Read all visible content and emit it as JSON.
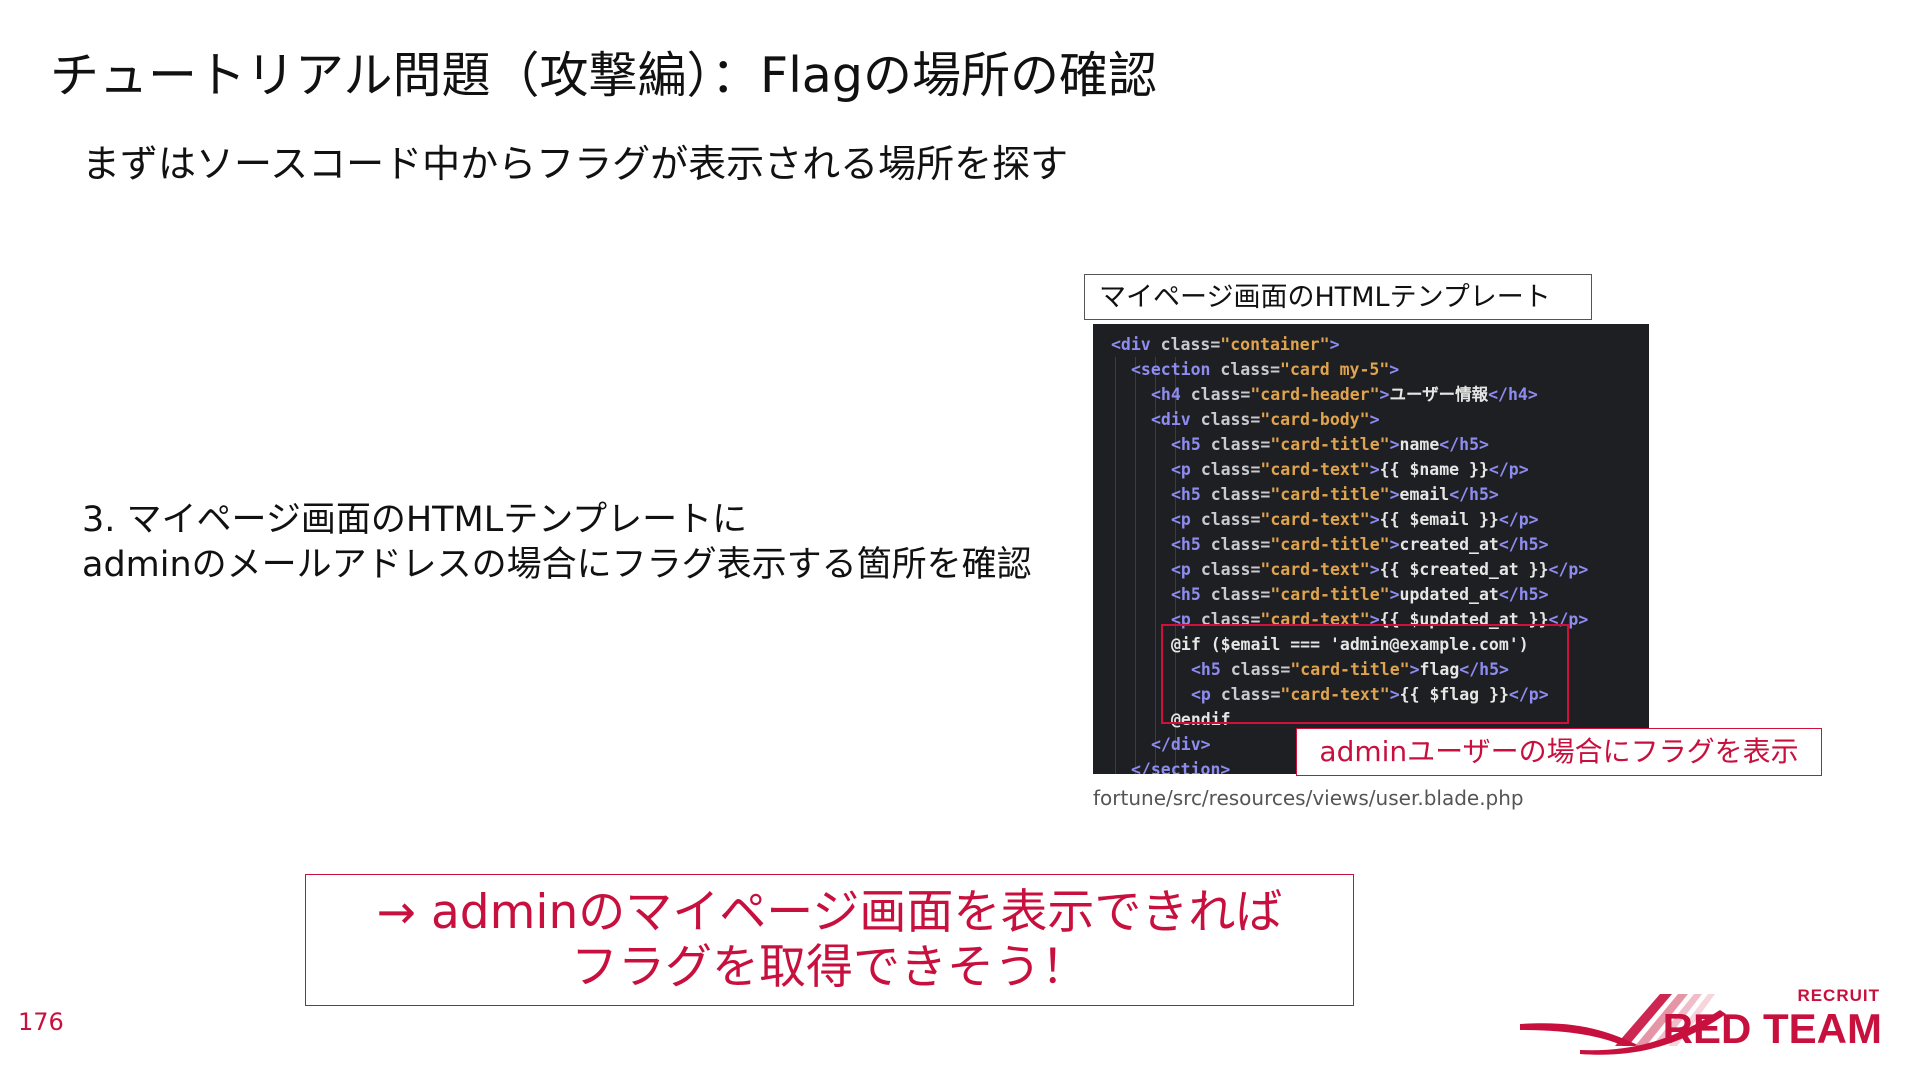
{
  "slide": {
    "title": "チュートリアル問題（攻撃編）：Flagの場所の確認",
    "subtitle": "まずはソースコード中からフラグが表示される場所を探す",
    "step_line1": "3. マイページ画面のHTMLテンプレートに",
    "step_line2": "adminのメールアドレスの場合にフラグ表示する箇所を確認",
    "code_label": "マイページ画面のHTMLテンプレート",
    "code_lines": [
      {
        "indent": 0,
        "tokens": [
          {
            "t": "<div ",
            "c": "tag"
          },
          {
            "t": "class=",
            "c": "attr"
          },
          {
            "t": "\"container\"",
            "c": "str"
          },
          {
            "t": ">",
            "c": "tag"
          }
        ]
      },
      {
        "indent": 1,
        "tokens": [
          {
            "t": "<section ",
            "c": "tag"
          },
          {
            "t": "class=",
            "c": "attr"
          },
          {
            "t": "\"card my-5\"",
            "c": "str"
          },
          {
            "t": ">",
            "c": "tag"
          }
        ]
      },
      {
        "indent": 2,
        "tokens": [
          {
            "t": "<h4 ",
            "c": "tag"
          },
          {
            "t": "class=",
            "c": "attr"
          },
          {
            "t": "\"card-header\"",
            "c": "str"
          },
          {
            "t": ">",
            "c": "tag"
          },
          {
            "t": "ユーザー情報",
            "c": "txt"
          },
          {
            "t": "</h4>",
            "c": "tag"
          }
        ]
      },
      {
        "indent": 2,
        "tokens": [
          {
            "t": "<div ",
            "c": "tag"
          },
          {
            "t": "class=",
            "c": "attr"
          },
          {
            "t": "\"card-body\"",
            "c": "str"
          },
          {
            "t": ">",
            "c": "tag"
          }
        ]
      },
      {
        "indent": 3,
        "tokens": [
          {
            "t": "<h5 ",
            "c": "tag"
          },
          {
            "t": "class=",
            "c": "attr"
          },
          {
            "t": "\"card-title\"",
            "c": "str"
          },
          {
            "t": ">",
            "c": "tag"
          },
          {
            "t": "name",
            "c": "txt"
          },
          {
            "t": "</h5>",
            "c": "tag"
          }
        ]
      },
      {
        "indent": 3,
        "tokens": [
          {
            "t": "<p ",
            "c": "tag"
          },
          {
            "t": "class=",
            "c": "attr"
          },
          {
            "t": "\"card-text\"",
            "c": "str"
          },
          {
            "t": ">",
            "c": "tag"
          },
          {
            "t": "{{ $name }}",
            "c": "txt"
          },
          {
            "t": "</p>",
            "c": "tag"
          }
        ]
      },
      {
        "indent": 3,
        "tokens": [
          {
            "t": "<h5 ",
            "c": "tag"
          },
          {
            "t": "class=",
            "c": "attr"
          },
          {
            "t": "\"card-title\"",
            "c": "str"
          },
          {
            "t": ">",
            "c": "tag"
          },
          {
            "t": "email",
            "c": "txt"
          },
          {
            "t": "</h5>",
            "c": "tag"
          }
        ]
      },
      {
        "indent": 3,
        "tokens": [
          {
            "t": "<p ",
            "c": "tag"
          },
          {
            "t": "class=",
            "c": "attr"
          },
          {
            "t": "\"card-text\"",
            "c": "str"
          },
          {
            "t": ">",
            "c": "tag"
          },
          {
            "t": "{{ $email }}",
            "c": "txt"
          },
          {
            "t": "</p>",
            "c": "tag"
          }
        ]
      },
      {
        "indent": 3,
        "tokens": [
          {
            "t": "<h5 ",
            "c": "tag"
          },
          {
            "t": "class=",
            "c": "attr"
          },
          {
            "t": "\"card-title\"",
            "c": "str"
          },
          {
            "t": ">",
            "c": "tag"
          },
          {
            "t": "created_at",
            "c": "txt"
          },
          {
            "t": "</h5>",
            "c": "tag"
          }
        ]
      },
      {
        "indent": 3,
        "tokens": [
          {
            "t": "<p ",
            "c": "tag"
          },
          {
            "t": "class=",
            "c": "attr"
          },
          {
            "t": "\"card-text\"",
            "c": "str"
          },
          {
            "t": ">",
            "c": "tag"
          },
          {
            "t": "{{ $created_at }}",
            "c": "txt"
          },
          {
            "t": "</p>",
            "c": "tag"
          }
        ]
      },
      {
        "indent": 3,
        "tokens": [
          {
            "t": "<h5 ",
            "c": "tag"
          },
          {
            "t": "class=",
            "c": "attr"
          },
          {
            "t": "\"card-title\"",
            "c": "str"
          },
          {
            "t": ">",
            "c": "tag"
          },
          {
            "t": "updated_at",
            "c": "txt"
          },
          {
            "t": "</h5>",
            "c": "tag"
          }
        ]
      },
      {
        "indent": 3,
        "tokens": [
          {
            "t": "<p ",
            "c": "tag"
          },
          {
            "t": "class=",
            "c": "attr"
          },
          {
            "t": "\"card-text\"",
            "c": "str"
          },
          {
            "t": ">",
            "c": "tag"
          },
          {
            "t": "{{ $updated_at }}",
            "c": "txt"
          },
          {
            "t": "</p>",
            "c": "tag"
          }
        ]
      },
      {
        "indent": 3,
        "tokens": [
          {
            "t": "@if ($email === ",
            "c": "txt"
          },
          {
            "t": "'admin@example.com'",
            "c": "txt"
          },
          {
            "t": ")",
            "c": "txt"
          }
        ]
      },
      {
        "indent": 4,
        "tokens": [
          {
            "t": "<h5 ",
            "c": "tag"
          },
          {
            "t": "class=",
            "c": "attr"
          },
          {
            "t": "\"card-title\"",
            "c": "str"
          },
          {
            "t": ">",
            "c": "tag"
          },
          {
            "t": "flag",
            "c": "txt"
          },
          {
            "t": "</h5>",
            "c": "tag"
          }
        ]
      },
      {
        "indent": 4,
        "tokens": [
          {
            "t": "<p ",
            "c": "tag"
          },
          {
            "t": "class=",
            "c": "attr"
          },
          {
            "t": "\"card-text\"",
            "c": "str"
          },
          {
            "t": ">",
            "c": "tag"
          },
          {
            "t": "{{ $flag }}",
            "c": "txt"
          },
          {
            "t": "</p>",
            "c": "tag"
          }
        ]
      },
      {
        "indent": 3,
        "tokens": [
          {
            "t": "@endif",
            "c": "txt"
          }
        ]
      },
      {
        "indent": 2,
        "tokens": [
          {
            "t": "</div>",
            "c": "tag"
          }
        ]
      },
      {
        "indent": 1,
        "tokens": [
          {
            "t": "</section>",
            "c": "tag"
          }
        ]
      }
    ],
    "callout": "adminユーザーの場合にフラグを表示",
    "file_path": "fortune/src/resources/views/user.blade.php",
    "conclusion_line1": "→ adminのマイページ画面を表示できれば",
    "conclusion_line2": "フラグを取得できそう！",
    "page_number": "176",
    "logo_small": "RECRUIT",
    "logo_big": "RED TEAM",
    "colors": {
      "accent": "#c8103e",
      "code_bg": "#1e1f22",
      "code_tag": "#8e8cf0",
      "code_string": "#e0a44e",
      "code_text": "#e6e6e6"
    }
  }
}
